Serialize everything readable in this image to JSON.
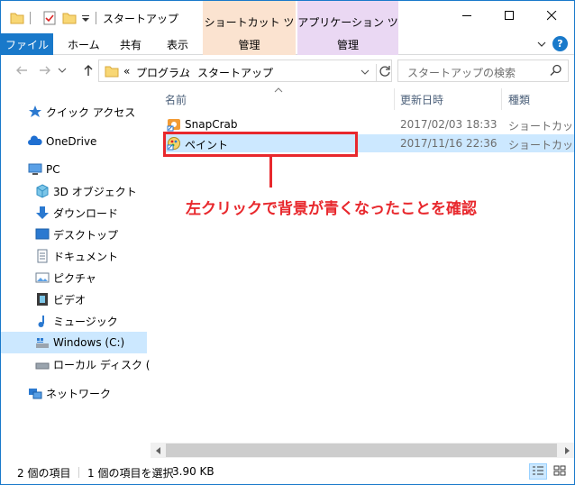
{
  "window": {
    "title": "スタートアップ",
    "minimize_glyph": "—",
    "maximize_glyph": "☐",
    "close_glyph": "✕"
  },
  "ribbon": {
    "context_group_1": "ショートカット ツール",
    "context_group_2": "アプリケーション ツール",
    "tabs": [
      "ファイル",
      "ホーム",
      "共有",
      "表示"
    ],
    "context_tab_1": "管理",
    "context_tab_2": "管理",
    "help": "?"
  },
  "address": {
    "overflow": "«",
    "crumbs": [
      "プログラム",
      "スタートアップ"
    ],
    "separator": "›",
    "search_placeholder": "スタートアップの検索"
  },
  "nav": {
    "quick_access": "クイック アクセス",
    "onedrive": "OneDrive",
    "pc": "PC",
    "pc_items": [
      "3D オブジェクト",
      "ダウンロード",
      "デスクトップ",
      "ドキュメント",
      "ピクチャ",
      "ビデオ",
      "ミュージック",
      "Windows (C:)",
      "ローカル ディスク (D:)"
    ],
    "network": "ネットワーク"
  },
  "columns": {
    "name": "名前",
    "modified": "更新日時",
    "type": "種類"
  },
  "files": [
    {
      "name": "SnapCrab",
      "modified": "2017/02/03 18:33",
      "type": "ショートカット"
    },
    {
      "name": "ペイント",
      "modified": "2017/11/16 22:36",
      "type": "ショートカット"
    }
  ],
  "annotation": "左クリックで背景が青くなったことを確認",
  "status": {
    "count": "2 個の項目",
    "selected": "1 個の項目を選択",
    "size": "3.90 KB"
  },
  "colors": {
    "accent": "#1979ca",
    "selection": "#cce8ff",
    "annotation": "#e8282d",
    "context_shortcut": "#fbe3d0",
    "context_app": "#ead8f3"
  }
}
